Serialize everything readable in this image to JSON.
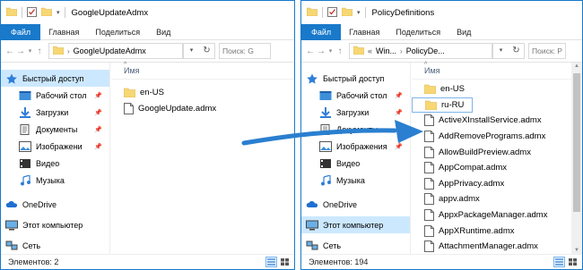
{
  "left_window": {
    "title": "GoogleUpdateAdmx",
    "tabs": [
      "Файл",
      "Главная",
      "Поделиться",
      "Вид"
    ],
    "address": {
      "segments": [
        "GoogleUpdateAdmx"
      ]
    },
    "search_placeholder": "Поиск: G",
    "nav": [
      {
        "label": "Быстрый доступ",
        "icon": "star-icon",
        "selected": true,
        "pinned": false
      },
      {
        "label": "Рабочий стол",
        "icon": "desktop-icon",
        "selected": false,
        "pinned": true
      },
      {
        "label": "Загрузки",
        "icon": "download-icon",
        "selected": false,
        "pinned": true
      },
      {
        "label": "Документы",
        "icon": "documents-icon",
        "selected": false,
        "pinned": true
      },
      {
        "label": "Изображени",
        "icon": "pictures-icon",
        "selected": false,
        "pinned": true
      },
      {
        "label": "Видео",
        "icon": "video-icon",
        "selected": false,
        "pinned": false
      },
      {
        "label": "Музыка",
        "icon": "music-icon",
        "selected": false,
        "pinned": false
      },
      {
        "label": "OneDrive",
        "icon": "onedrive-icon",
        "selected": false,
        "pinned": false
      },
      {
        "label": "Этот компьютер",
        "icon": "computer-icon",
        "selected": false,
        "pinned": false
      },
      {
        "label": "Сеть",
        "icon": "network-icon",
        "selected": false,
        "pinned": false
      }
    ],
    "column_header": "Имя",
    "files": [
      {
        "name": "en-US",
        "type": "folder"
      },
      {
        "name": "GoogleUpdate.admx",
        "type": "file"
      }
    ],
    "status": "Элементов: 2"
  },
  "right_window": {
    "title": "PolicyDefinitions",
    "tabs": [
      "Файл",
      "Главная",
      "Поделиться",
      "Вид"
    ],
    "address": {
      "prefix": "«",
      "segments": [
        "Win...",
        "PolicyDe..."
      ]
    },
    "search_placeholder": "Поиск: P",
    "nav": [
      {
        "label": "Быстрый доступ",
        "icon": "star-icon",
        "selected": false,
        "pinned": false
      },
      {
        "label": "Рабочий стол",
        "icon": "desktop-icon",
        "selected": false,
        "pinned": true
      },
      {
        "label": "Загрузки",
        "icon": "download-icon",
        "selected": false,
        "pinned": true
      },
      {
        "label": "Документы",
        "icon": "documents-icon",
        "selected": false,
        "pinned": true
      },
      {
        "label": "Изображения",
        "icon": "pictures-icon",
        "selected": false,
        "pinned": true
      },
      {
        "label": "Видео",
        "icon": "video-icon",
        "selected": false,
        "pinned": false
      },
      {
        "label": "Музыка",
        "icon": "music-icon",
        "selected": false,
        "pinned": false
      },
      {
        "label": "OneDrive",
        "icon": "onedrive-icon",
        "selected": false,
        "pinned": false
      },
      {
        "label": "Этот компьютер",
        "icon": "computer-icon",
        "selected": true,
        "pinned": false
      },
      {
        "label": "Сеть",
        "icon": "network-icon",
        "selected": false,
        "pinned": false
      }
    ],
    "column_header": "Имя",
    "files": [
      {
        "name": "en-US",
        "type": "folder"
      },
      {
        "name": "ru-RU",
        "type": "folder",
        "selected": true
      },
      {
        "name": "ActiveXInstallService.admx",
        "type": "file"
      },
      {
        "name": "AddRemovePrograms.admx",
        "type": "file"
      },
      {
        "name": "AllowBuildPreview.admx",
        "type": "file"
      },
      {
        "name": "AppCompat.admx",
        "type": "file"
      },
      {
        "name": "AppPrivacy.admx",
        "type": "file"
      },
      {
        "name": "appv.admx",
        "type": "file"
      },
      {
        "name": "AppxPackageManager.admx",
        "type": "file"
      },
      {
        "name": "AppXRuntime.admx",
        "type": "file"
      },
      {
        "name": "AttachmentManager.admx",
        "type": "file"
      }
    ],
    "status": "Элементов: 194"
  },
  "colors": {
    "accent": "#1979ca",
    "arrow": "#2a7fd0",
    "folder": "#f7d774",
    "selection": "#cce8ff"
  }
}
